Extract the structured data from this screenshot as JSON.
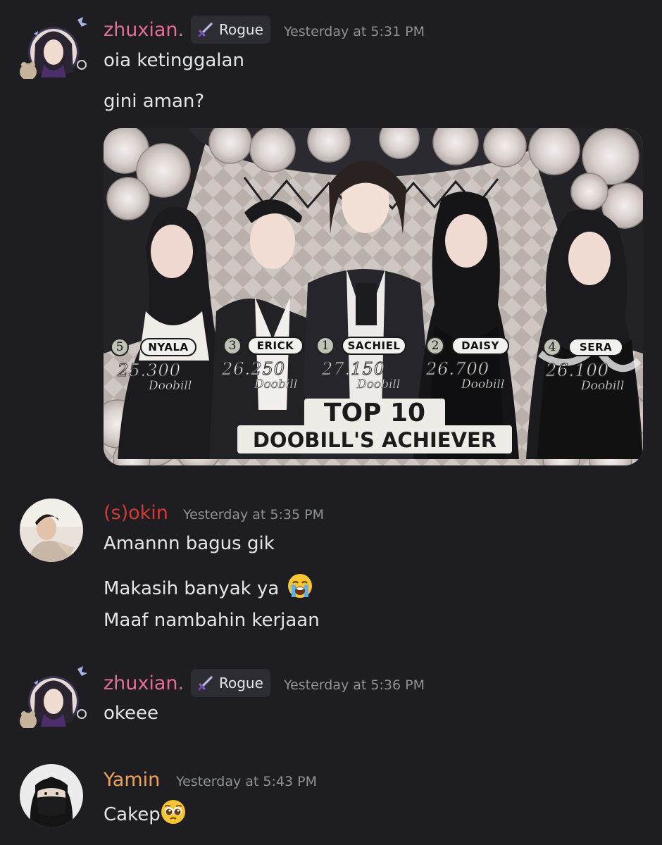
{
  "messages": [
    {
      "username": "zhuxian.",
      "username_color": "#e26e92",
      "badge": "Rogue",
      "badge_icon": "sword-icon",
      "timestamp": "Yesterday at 5:31 PM",
      "lines": [
        "oia ketinggalan",
        "gini aman?"
      ],
      "attachment": {
        "type": "image",
        "nominees": [
          {
            "rank": "5",
            "name": "NYALA",
            "score": "25.300",
            "unit": "Doobill"
          },
          {
            "rank": "3",
            "name": "ERICK",
            "score": "26.250",
            "unit": "Doobill"
          },
          {
            "rank": "1",
            "name": "SACHIEL",
            "score": "27.150",
            "unit": "Doobill"
          },
          {
            "rank": "2",
            "name": "DAISY",
            "score": "26.700",
            "unit": "Doobill"
          },
          {
            "rank": "4",
            "name": "SERA",
            "score": "26.100",
            "unit": "Doobill"
          }
        ],
        "title_line1": "TOP 10",
        "title_line2": "DOOBILL'S ACHIEVER"
      }
    },
    {
      "username": "(s)okin",
      "username_color": "#d6392f",
      "timestamp": "Yesterday at 5:35 PM",
      "lines": [
        "Amannn bagus gik",
        "Makasih banyak ya",
        "Maaf nambahin kerjaan"
      ],
      "emoji": "loudly-crying-face"
    },
    {
      "username": "zhuxian.",
      "username_color": "#e26e92",
      "badge": "Rogue",
      "badge_icon": "sword-icon",
      "timestamp": "Yesterday at 5:36 PM",
      "lines": [
        "okeee"
      ]
    },
    {
      "username": "Yamin",
      "username_color": "#f0a15c",
      "timestamp": "Yesterday at 5:43 PM",
      "lines": [
        "Cakep"
      ],
      "emoji": "pleading-face"
    }
  ]
}
